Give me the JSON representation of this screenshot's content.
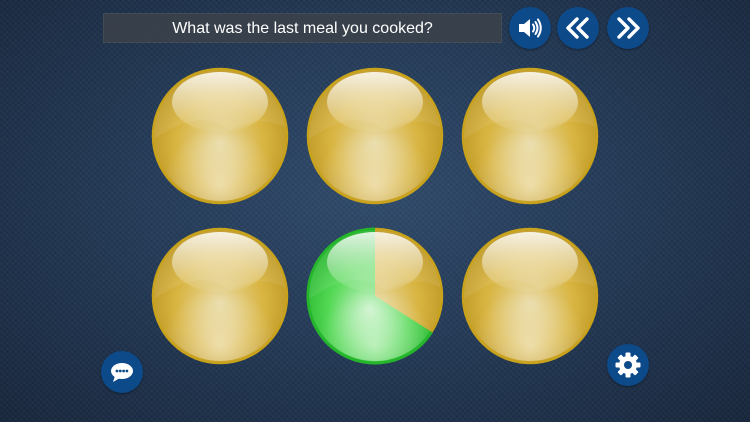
{
  "prompt": {
    "question": "What was the last meal you cooked?"
  },
  "toolbar": {
    "sound_icon": "speaker-icon",
    "back_icon": "double-chevron-left-icon",
    "next_icon": "double-chevron-right-icon"
  },
  "footer": {
    "chat_icon": "chat-bubble-icon",
    "settings_icon": "gear-icon"
  },
  "colors": {
    "button": "#0d4a8a",
    "orb_gold": "#d9b43a",
    "orb_green": "#2ecc40",
    "question_bar": "#3c424a"
  },
  "orbs": [
    {
      "state": "idle"
    },
    {
      "state": "idle"
    },
    {
      "state": "idle"
    },
    {
      "state": "idle"
    },
    {
      "state": "timer",
      "progress": 0.66
    },
    {
      "state": "idle"
    }
  ]
}
